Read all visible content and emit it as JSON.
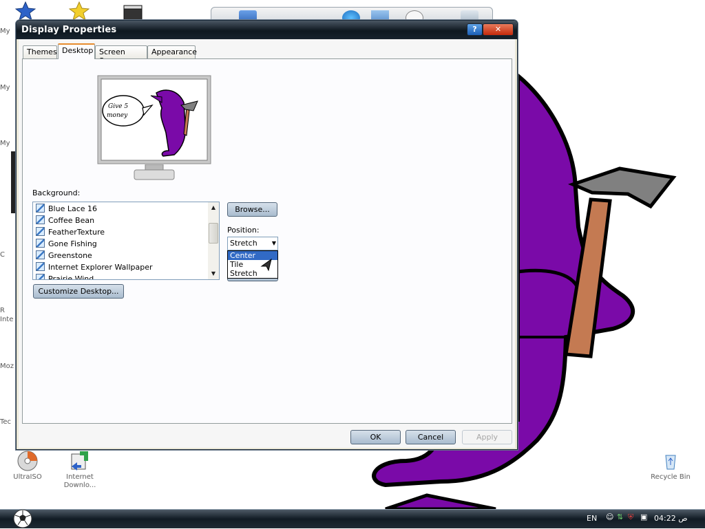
{
  "window": {
    "title": "Display Properties",
    "help_label": "?",
    "close_label": "✕"
  },
  "tabs": [
    {
      "label": "Themes"
    },
    {
      "label": "Desktop"
    },
    {
      "label": "Screen Saver"
    },
    {
      "label": "Appearance"
    }
  ],
  "background": {
    "label": "Background:",
    "items": [
      "Blue Lace 16",
      "Coffee Bean",
      "FeatherTexture",
      "Gone Fishing",
      "Greenstone",
      "Internet Explorer Wallpaper",
      "Prairie Wind"
    ],
    "scroll_up": "▲",
    "scroll_down": "▼"
  },
  "browse_label": "Browse...",
  "position": {
    "label": "Position:",
    "selected": "Stretch",
    "arrow": "▼",
    "options": [
      "Center",
      "Tile",
      "Stretch"
    ]
  },
  "customize_label": "Customize Desktop...",
  "footer": {
    "ok_label": "OK",
    "cancel_label": "Cancel",
    "apply_label": "Apply"
  },
  "preview": {
    "speech_text_1": "Give 5",
    "speech_text_2": "money"
  },
  "desktop_icons": [
    {
      "label": "UltraISO",
      "icon": "disc-icon"
    },
    {
      "label": "Internet Downlo...",
      "icon": "download-manager-icon"
    },
    {
      "label": "Recycle Bin",
      "icon": "recycle-bin-icon"
    }
  ],
  "left_stubs": [
    "My",
    "My",
    "My",
    "C",
    "R",
    "Inte",
    "Moz",
    "Tec"
  ],
  "taskbar": {
    "language": "EN",
    "clock": "04:22 ص"
  },
  "colors": {
    "monster_purple": "#7a0aa8",
    "axe_handle": "#c47a52",
    "axe_head": "#808080",
    "taskbar_dark": "#111b24",
    "selection_blue": "#316ac5"
  }
}
